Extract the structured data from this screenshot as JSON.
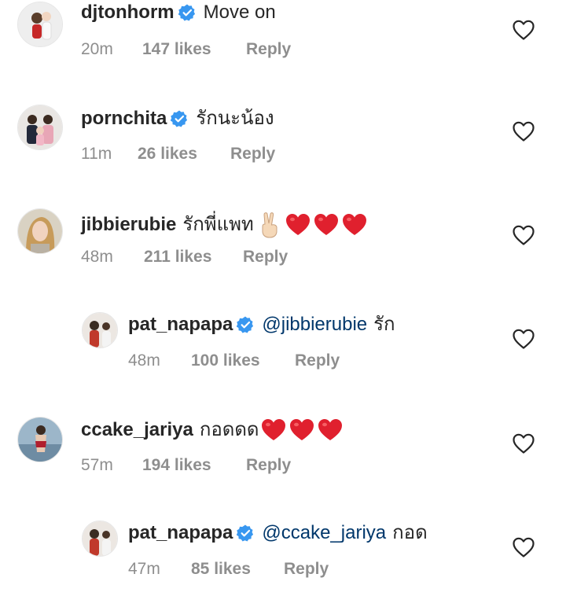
{
  "comments": [
    {
      "username": "djtonhorm",
      "verified": true,
      "text": "Move on",
      "time": "20m",
      "likes": "147 likes",
      "reply": "Reply"
    },
    {
      "username": "pornchita",
      "verified": true,
      "text": "รักนะน้อง",
      "time": "11m",
      "likes": "26 likes",
      "reply": "Reply"
    },
    {
      "username": "jibbierubie",
      "verified": false,
      "text": "รักพี่แพท",
      "emoji": [
        "victory-hand",
        "red-heart",
        "red-heart",
        "red-heart"
      ],
      "time": "48m",
      "likes": "211 likes",
      "reply": "Reply"
    },
    {
      "username": "pat_napapa",
      "verified": true,
      "mention": "@jibbierubie",
      "text": "รัก",
      "time": "48m",
      "likes": "100 likes",
      "reply": "Reply",
      "is_reply": true
    },
    {
      "username": "ccake_jariya",
      "verified": false,
      "text": "กอดดด",
      "emoji": [
        "red-heart",
        "red-heart",
        "red-heart"
      ],
      "time": "57m",
      "likes": "194 likes",
      "reply": "Reply"
    },
    {
      "username": "pat_napapa",
      "verified": true,
      "mention": "@ccake_jariya",
      "text": "กอด",
      "time": "47m",
      "likes": "85 likes",
      "reply": "Reply",
      "is_reply": true
    }
  ],
  "colors": {
    "text": "#262626",
    "meta": "#8e8e8e",
    "verified": "#3897f0",
    "mention": "#00376b",
    "heart": "#e0245e"
  }
}
